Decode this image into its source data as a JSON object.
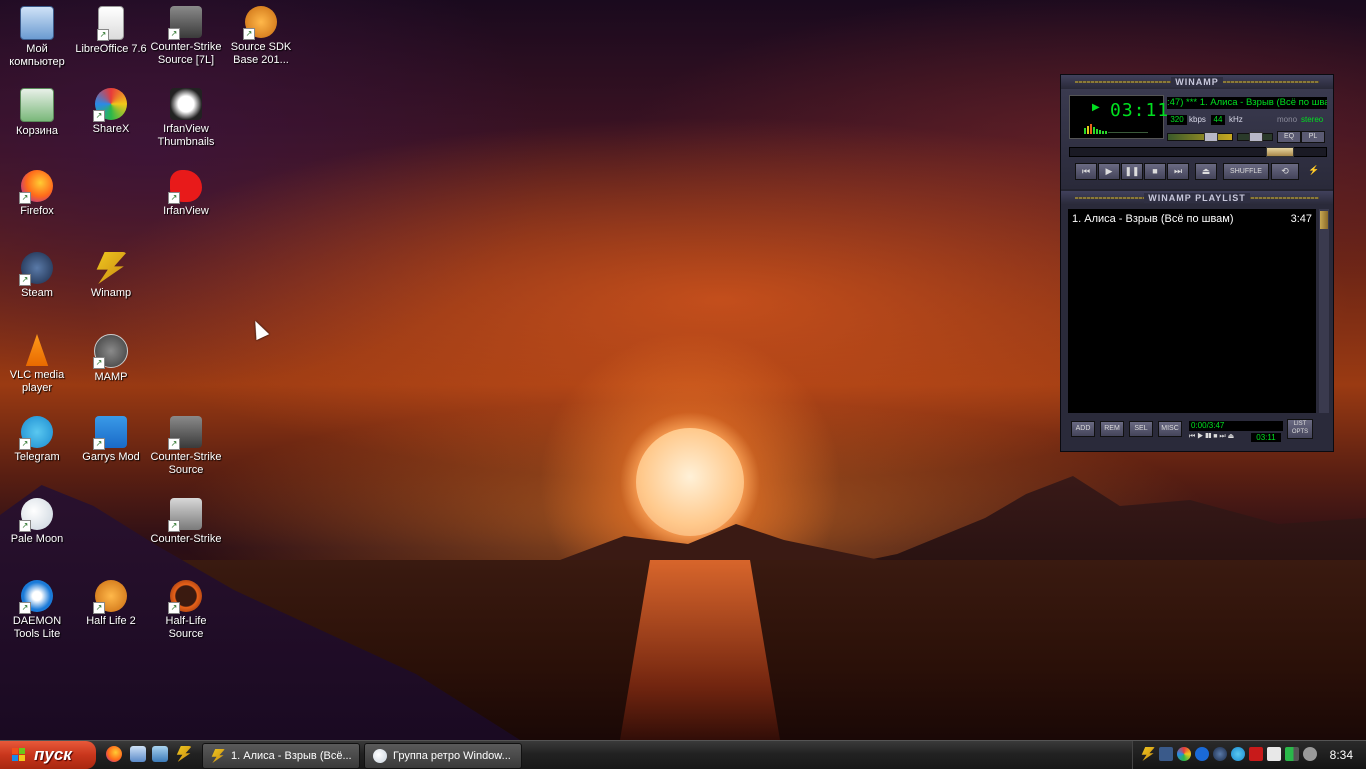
{
  "desktop": {
    "icons": [
      {
        "label": "Мой компьютер"
      },
      {
        "label": "LibreOffice 7.6"
      },
      {
        "label": "Counter-Strike Source [7L]"
      },
      {
        "label": "Source SDK Base 201..."
      },
      {
        "label": "Корзина"
      },
      {
        "label": "ShareX"
      },
      {
        "label": "IrfanView Thumbnails"
      },
      {
        "label": "Firefox"
      },
      {
        "label": "IrfanView"
      },
      {
        "label": "Steam"
      },
      {
        "label": "Winamp"
      },
      {
        "label": "VLC media player"
      },
      {
        "label": "MAMP"
      },
      {
        "label": "Telegram"
      },
      {
        "label": "Garrys Mod"
      },
      {
        "label": "Counter-Strike Source"
      },
      {
        "label": "Pale Moon"
      },
      {
        "label": "Counter-Strike"
      },
      {
        "label": "DAEMON Tools Lite"
      },
      {
        "label": "Half Life 2"
      },
      {
        "label": "Half-Life Source"
      }
    ]
  },
  "winamp": {
    "title": "WINAMP",
    "time": "03:11",
    "marquee": ":47) *** 1. Алиса - Взрыв (Всё по швам)",
    "kbps_value": "320",
    "kbps_label": "kbps",
    "khz_value": "44",
    "khz_label": "kHz",
    "mono": "mono",
    "stereo": "stereo",
    "eq_btn": "EQ",
    "pl_btn": "PL",
    "shuffle": "SHUFFLE",
    "playlist_title": "WINAMP PLAYLIST",
    "playlist": [
      {
        "title": "1. Алиса - Взрыв (Всё по швам)",
        "duration": "3:47"
      }
    ],
    "pl_buttons": {
      "add": "ADD",
      "rem": "REM",
      "sel": "SEL",
      "misc": "MISC",
      "list_opts": "LIST OPTS"
    },
    "pl_time": "0:00/3:47",
    "pl_time2": "03:11"
  },
  "taskbar": {
    "start_label": "пуск",
    "tasks": [
      {
        "label": "1. Алиса - Взрыв (Всё..."
      },
      {
        "label": "Группа ретро Window..."
      }
    ],
    "clock": "8:34"
  }
}
